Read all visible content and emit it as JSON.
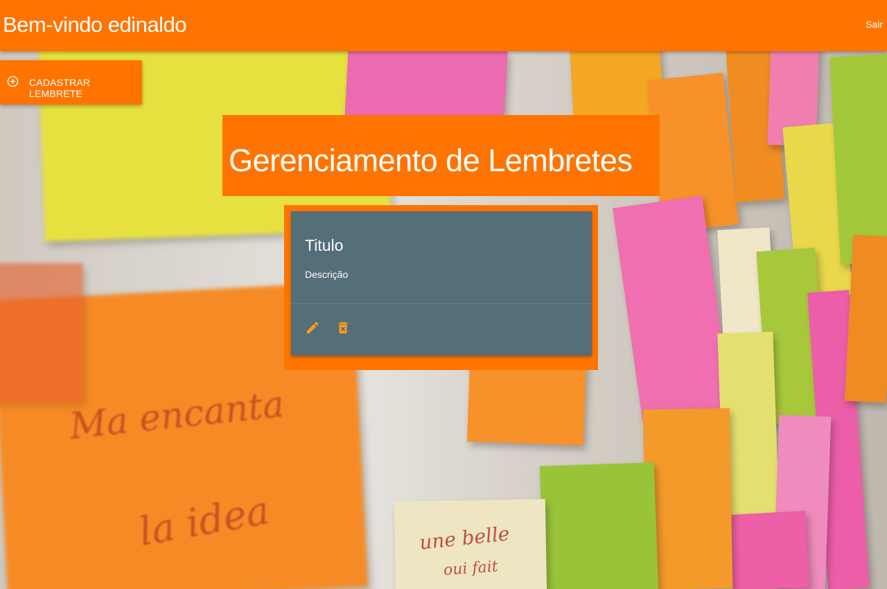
{
  "navbar": {
    "brand": "Bem-vindo edinaldo",
    "logout_label": "Sair"
  },
  "add_button": {
    "label": "CADASTRAR LEMBRETE",
    "icon": "add-circle-icon"
  },
  "page_title": "Gerenciamento de Lembretes",
  "reminders": [
    {
      "title": "Titulo",
      "description": "Descrição",
      "actions": [
        {
          "icon": "edit-icon"
        },
        {
          "icon": "delete-icon"
        }
      ]
    }
  ],
  "colors": {
    "accent": "#ff7400",
    "card": "#546e7a",
    "text": "#ffffff",
    "action_icon": "#ff9f1a"
  },
  "background": {
    "description_texts": [
      "Ma encanta",
      "la idea",
      "une belle",
      "oui fait"
    ]
  }
}
